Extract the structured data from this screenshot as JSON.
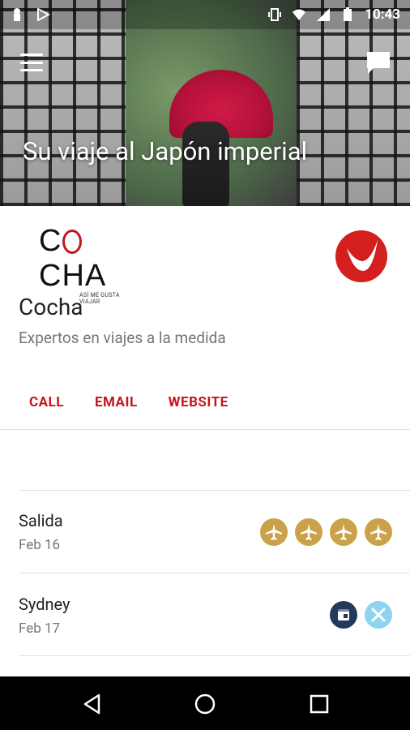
{
  "statusbar": {
    "time": "10:43"
  },
  "hero": {
    "title": "Su viaje al Japón imperial"
  },
  "brand": {
    "logo_text": "COCHA",
    "logo_tagline": "ASÍ ME GUSTA VIAJAR"
  },
  "company": {
    "name": "Cocha",
    "subtitle": "Expertos en viajes a la medida"
  },
  "actions": {
    "call": "CALL",
    "email": "EMAIL",
    "website": "WEBSITE"
  },
  "itinerary": [
    {
      "title": "Salida",
      "date": "Feb 16",
      "icons": [
        "airplane-icon",
        "airplane-icon",
        "airplane-icon",
        "airplane-icon"
      ]
    },
    {
      "title": "Sydney",
      "date": "Feb 17",
      "icons": [
        "hotel-icon",
        "restaurant-icon"
      ]
    }
  ],
  "colors": {
    "accent": "#c4161c",
    "plane_badge": "#c9a24a",
    "hotel_badge": "#233a5c",
    "food_badge": "#8fd3f0"
  }
}
